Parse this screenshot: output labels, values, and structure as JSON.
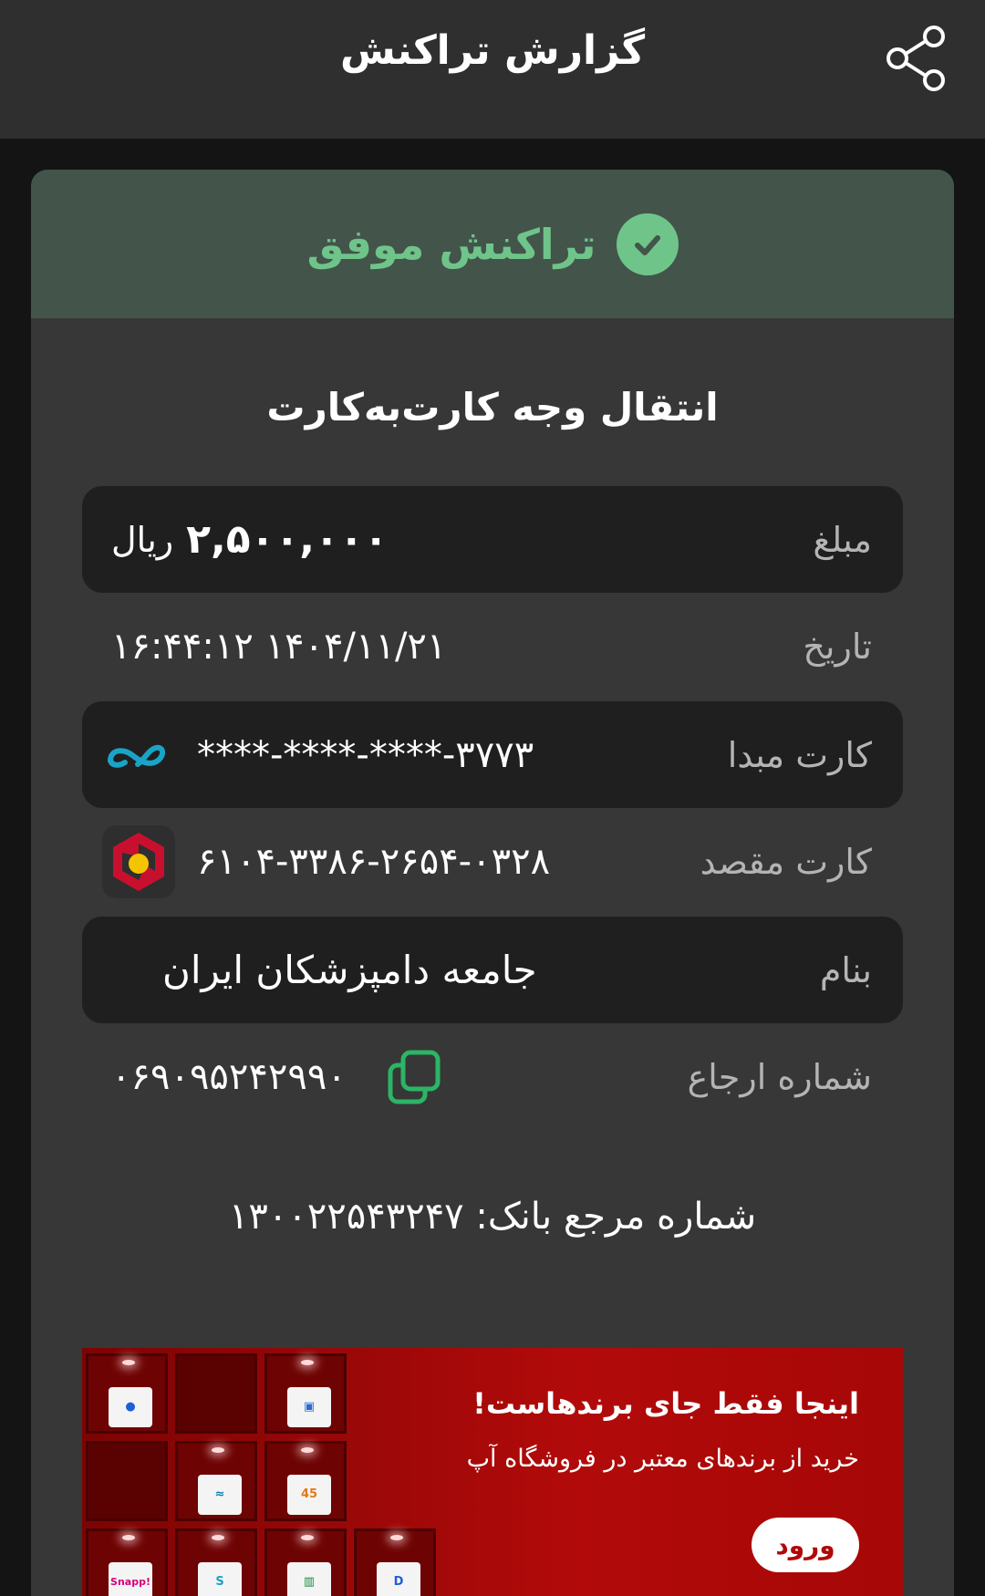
{
  "header": {
    "title": "گزارش تراکنش",
    "share_icon": "share-icon"
  },
  "status": {
    "text": "تراکنش موفق",
    "icon": "check-circle-icon",
    "color": "#6fc48a"
  },
  "transaction": {
    "type": "انتقال وجه کارت‌به‌کارت",
    "amount_label": "مبلغ",
    "amount_value": "۲,۵۰۰,۰۰۰",
    "amount_unit": "ریال",
    "date_label": "تاریخ",
    "date_value": "۱۶:۴۴:۱۲ ۱۴۰۴/۱۱/۲۱",
    "source_label": "کارت مبدا",
    "source_value": "****-****-****-۳۷۷۳",
    "source_bank_icon": "bank-logo-icon",
    "dest_label": "کارت مقصد",
    "dest_value": "۶۱۰۴-۳۳۸۶-۲۶۵۴-۰۳۲۸",
    "dest_bank_icon": "bank-mellat-logo-icon",
    "name_label": "بنام",
    "name_value": "جامعه دامپزشکان ایران",
    "ref_label": "شماره ارجاع",
    "ref_value": "۰۶۹۰۹۵۲۴۲۹۹۰",
    "copy_icon": "copy-icon"
  },
  "bank_ref": {
    "text": "شماره مرجع بانک: ۱۳۰۰۲۲۵۴۳۲۴۷"
  },
  "banner": {
    "title": "اینجا فقط جای برندهاست!",
    "subtitle": "خرید از برندهای معتبر در فروشگاه آپ",
    "button_label": "ورود",
    "product_45": "45",
    "product_snapp": "Snapp!",
    "accent": "#b20a0a"
  }
}
